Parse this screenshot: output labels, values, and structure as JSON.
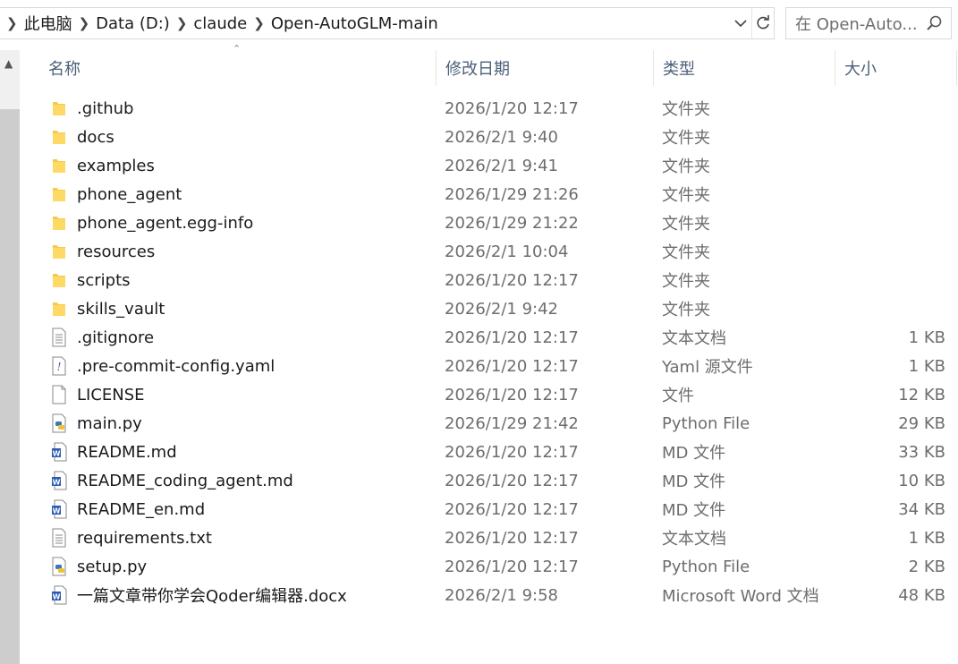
{
  "address": {
    "breadcrumbs": [
      "此电脑",
      "Data (D:)",
      "claude",
      "Open-AutoGLM-main"
    ]
  },
  "search": {
    "placeholder": "在 Open-Auto..."
  },
  "columns": {
    "name": "名称",
    "date": "修改日期",
    "type": "类型",
    "size": "大小"
  },
  "files": [
    {
      "name": ".github",
      "date": "2026/1/20 12:17",
      "type": "文件夹",
      "size": "",
      "icon": "folder-icon"
    },
    {
      "name": "docs",
      "date": "2026/2/1 9:40",
      "type": "文件夹",
      "size": "",
      "icon": "folder-icon"
    },
    {
      "name": "examples",
      "date": "2026/2/1 9:41",
      "type": "文件夹",
      "size": "",
      "icon": "folder-icon"
    },
    {
      "name": "phone_agent",
      "date": "2026/1/29 21:26",
      "type": "文件夹",
      "size": "",
      "icon": "folder-icon"
    },
    {
      "name": "phone_agent.egg-info",
      "date": "2026/1/29 21:22",
      "type": "文件夹",
      "size": "",
      "icon": "folder-icon"
    },
    {
      "name": "resources",
      "date": "2026/2/1 10:04",
      "type": "文件夹",
      "size": "",
      "icon": "folder-icon"
    },
    {
      "name": "scripts",
      "date": "2026/1/20 12:17",
      "type": "文件夹",
      "size": "",
      "icon": "folder-icon"
    },
    {
      "name": "skills_vault",
      "date": "2026/2/1 9:42",
      "type": "文件夹",
      "size": "",
      "icon": "folder-icon"
    },
    {
      "name": ".gitignore",
      "date": "2026/1/20 12:17",
      "type": "文本文档",
      "size": "1 KB",
      "icon": "text-file-icon"
    },
    {
      "name": ".pre-commit-config.yaml",
      "date": "2026/1/20 12:17",
      "type": "Yaml 源文件",
      "size": "1 KB",
      "icon": "yaml-file-icon"
    },
    {
      "name": "LICENSE",
      "date": "2026/1/20 12:17",
      "type": "文件",
      "size": "12 KB",
      "icon": "blank-file-icon"
    },
    {
      "name": "main.py",
      "date": "2026/1/29 21:42",
      "type": "Python File",
      "size": "29 KB",
      "icon": "python-file-icon"
    },
    {
      "name": "README.md",
      "date": "2026/1/20 12:17",
      "type": "MD 文件",
      "size": "33 KB",
      "icon": "word-file-icon"
    },
    {
      "name": "README_coding_agent.md",
      "date": "2026/1/20 12:17",
      "type": "MD 文件",
      "size": "10 KB",
      "icon": "word-file-icon"
    },
    {
      "name": "README_en.md",
      "date": "2026/1/20 12:17",
      "type": "MD 文件",
      "size": "34 KB",
      "icon": "word-file-icon"
    },
    {
      "name": "requirements.txt",
      "date": "2026/1/20 12:17",
      "type": "文本文档",
      "size": "1 KB",
      "icon": "text-file-icon"
    },
    {
      "name": "setup.py",
      "date": "2026/1/20 12:17",
      "type": "Python File",
      "size": "2 KB",
      "icon": "python-file-icon"
    },
    {
      "name": "一篇文章带你学会Qoder编辑器.docx",
      "date": "2026/2/1 9:58",
      "type": "Microsoft Word 文档",
      "size": "48 KB",
      "icon": "word-file-icon"
    }
  ]
}
